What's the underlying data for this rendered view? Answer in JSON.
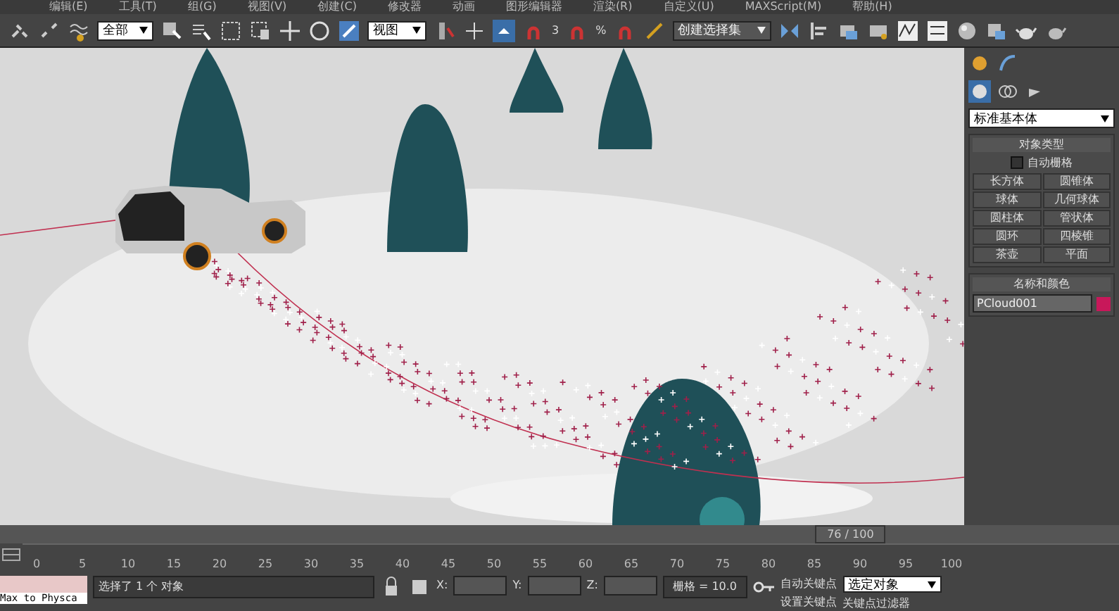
{
  "menu": [
    "编辑(E)",
    "工具(T)",
    "组(G)",
    "视图(V)",
    "创建(C)",
    "修改器",
    "动画",
    "图形编辑器",
    "渲染(R)",
    "自定义(U)",
    "MAXScript(M)",
    "帮助(H)"
  ],
  "toolbar": {
    "selection_filter": "全部",
    "reference_coord": "视图",
    "snap_counts": [
      "3",
      "%"
    ],
    "named_selection": "创建选择集"
  },
  "command_panel": {
    "category": "标准基本体",
    "object_type": {
      "title": "对象类型",
      "autogrid": {
        "label": "自动栅格",
        "checked": false
      },
      "buttons": [
        "长方体",
        "圆锥体",
        "球体",
        "几何球体",
        "圆柱体",
        "管状体",
        "圆环",
        "四棱锥",
        "茶壶",
        "平面"
      ]
    },
    "name_color": {
      "title": "名称和颜色",
      "name": "PCloud001",
      "color": "#c8185a"
    }
  },
  "timeline": {
    "slider_label": "76 / 100",
    "level": 0.76,
    "ticks": [
      "0",
      "5",
      "10",
      "15",
      "20",
      "25",
      "30",
      "35",
      "40",
      "45",
      "50",
      "55",
      "60",
      "65",
      "70",
      "75",
      "80",
      "85",
      "90",
      "95",
      "100"
    ]
  },
  "status": {
    "listener": "Max to Physca",
    "selection": "选择了 1 个 对象",
    "x_label": "X:",
    "y_label": "Y:",
    "z_label": "Z:",
    "grid": "栅格 = 10.0",
    "auto_key": "自动关键点",
    "key_mode": "选定对象",
    "set_key": "设置关键点",
    "key_filters": "关键点过滤器"
  }
}
